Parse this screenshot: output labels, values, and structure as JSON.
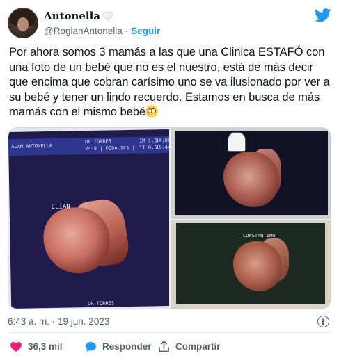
{
  "author": {
    "display_name": "Antonella",
    "handle": "@RoglanAntonella",
    "separator": "·",
    "follow_label": "Seguir"
  },
  "tweet": {
    "text": "Por ahora somos 3 mamás a las que una Clinica ESTAFÓ con una foto de un bebé que no es el nuestro, está de más decir que encima que cobran carísimo uno se va ilusionado por ver a su bebé y tener un lindo recuerdo. Estamos en busca de más mamás con el mismo bebé"
  },
  "media": {
    "left_header": [
      "ALAN ANTONELLA",
      "DR TORRES",
      "V4-8 | PODALICA |",
      "IM 1.3",
      "TI 0.5",
      "14:06",
      "19:44"
    ],
    "left_label": "ELIAN",
    "left_footer": "DR TORRES",
    "bottom_right_label": "CONSTANTINO"
  },
  "meta": {
    "timestamp": "6:43 a. m. · 19 jun. 2023"
  },
  "actions": {
    "likes": "36,3 mil",
    "reply_label": "Responder",
    "share_label": "Compartir"
  },
  "colors": {
    "accent": "#1d9bf0",
    "like": "#f91880",
    "secondary_text": "#536471"
  },
  "icons": [
    "white-heart-icon",
    "twitter-bird-icon",
    "emoji-icon",
    "info-icon",
    "like-heart-icon",
    "reply-bubble-icon",
    "share-icon"
  ]
}
